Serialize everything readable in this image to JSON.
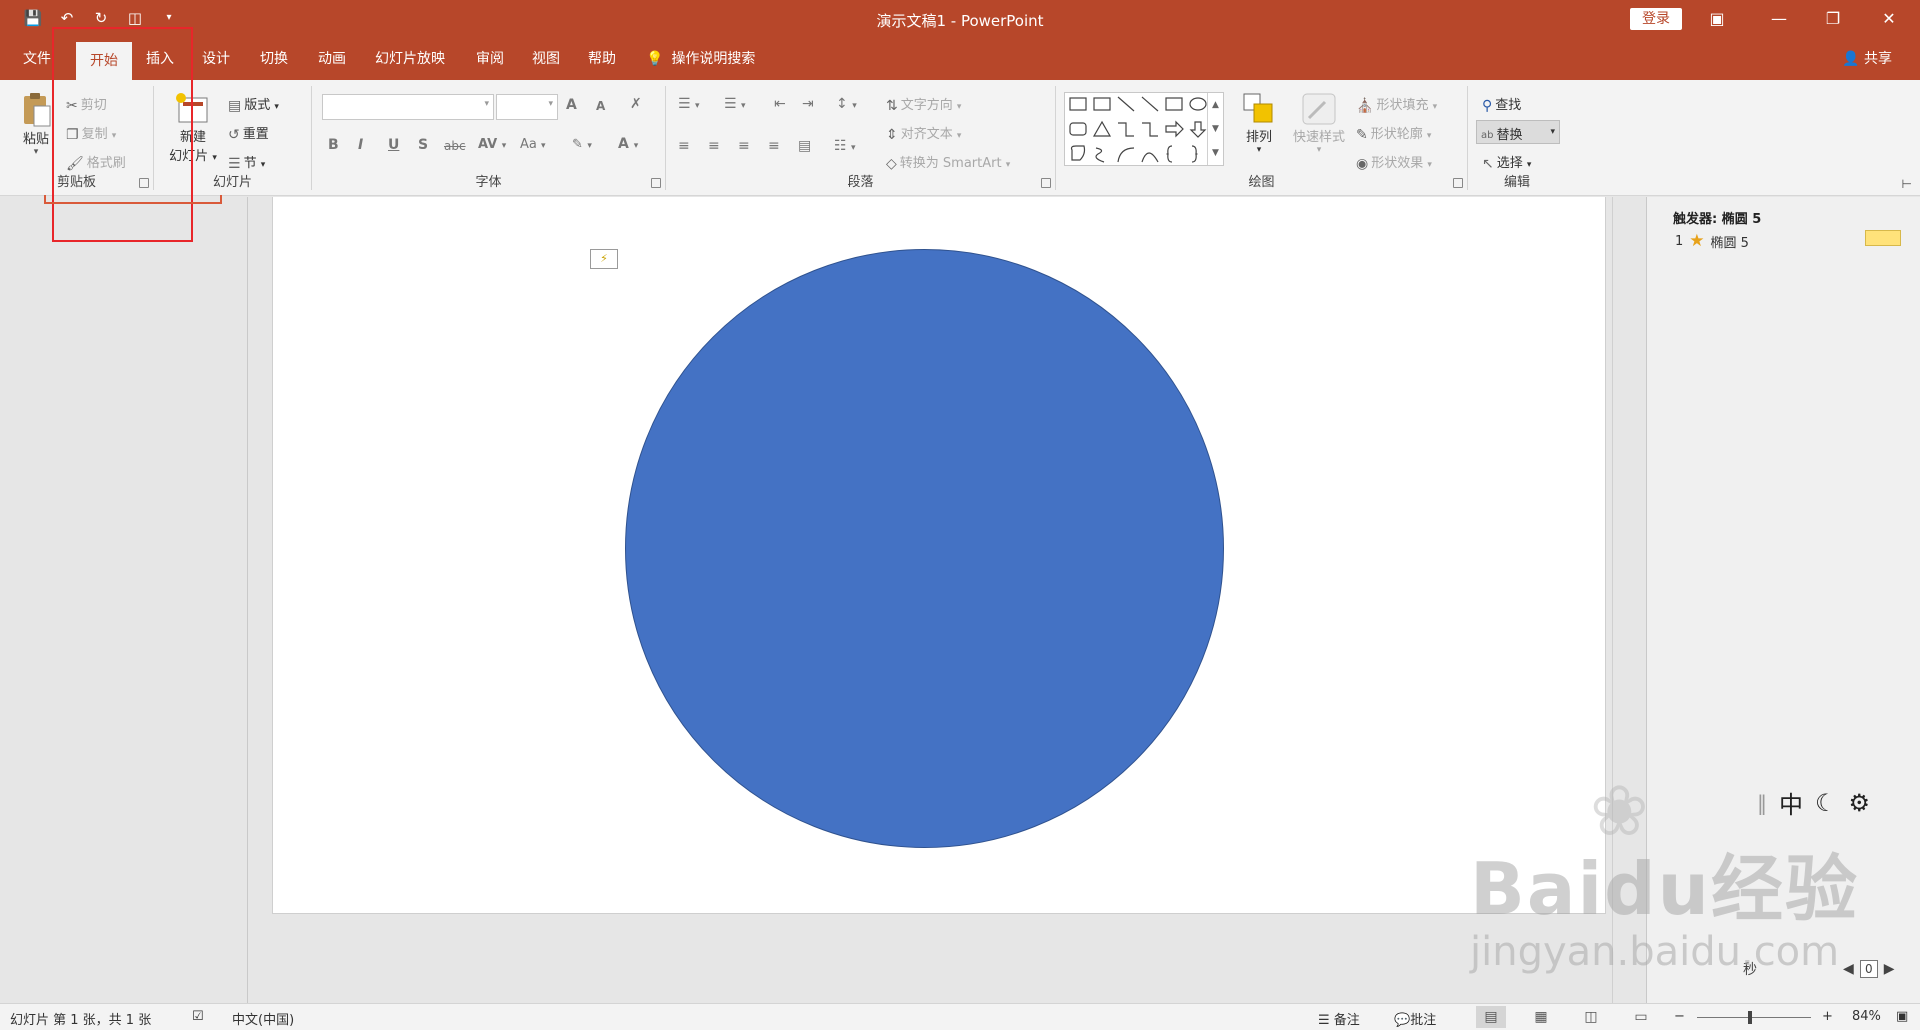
{
  "app": {
    "title": "演示文稿1  -  PowerPoint",
    "login": "登录",
    "accent": "#b7472a"
  },
  "qat": {
    "icons": [
      "save-icon",
      "undo-icon",
      "redo-icon",
      "slideshow-from-start-icon",
      "customize-qat-icon"
    ]
  },
  "tabs": [
    {
      "label": "文件",
      "active": false
    },
    {
      "label": "开始",
      "active": true
    },
    {
      "label": "插入",
      "active": false
    },
    {
      "label": "设计",
      "active": false
    },
    {
      "label": "切换",
      "active": false
    },
    {
      "label": "动画",
      "active": false
    },
    {
      "label": "幻灯片放映",
      "active": false
    },
    {
      "label": "审阅",
      "active": false
    },
    {
      "label": "视图",
      "active": false
    },
    {
      "label": "帮助",
      "active": false
    }
  ],
  "tell_me": "操作说明搜索",
  "share": "共享",
  "ribbon": {
    "clipboard": {
      "label": "剪贴板",
      "paste": "粘贴",
      "cut": "剪切",
      "copy": "复制",
      "format_painter": "格式刷"
    },
    "slides": {
      "label": "幻灯片",
      "new_slide_line1": "新建",
      "new_slide_line2": "幻灯片",
      "layout": "版式",
      "reset": "重置",
      "section": "节"
    },
    "font": {
      "label": "字体",
      "bold": "B",
      "italic": "I",
      "underline": "U",
      "shadow": "S",
      "strike": "abc",
      "spacing": "AV",
      "case": "Aa",
      "grow": "A",
      "shrink": "A"
    },
    "paragraph": {
      "label": "段落",
      "text_direction": "文字方向",
      "align_text": "对齐文本",
      "smartart": "转换为 SmartArt"
    },
    "drawing": {
      "label": "绘图",
      "arrange": "排列",
      "quick_styles": "快速样式",
      "shape_fill": "形状填充",
      "shape_outline": "形状轮廓",
      "shape_effects": "形状效果"
    },
    "editing": {
      "label": "编辑",
      "find": "查找",
      "replace": "替换",
      "select": "选择"
    }
  },
  "slide": {
    "shape_color": "#4472c4",
    "anim_tag": "⚡"
  },
  "animation_pane": {
    "trigger": "触发器: 椭圆 5",
    "item_index": "1",
    "item_name": "椭圆 5",
    "lang_cn": "中",
    "seconds_label": "秒",
    "page_box": "0"
  },
  "statusbar": {
    "slide_info": "幻灯片 第 1 张，共 1 张",
    "language": "中文(中国)",
    "notes": "备注",
    "comments": "批注",
    "zoom": "84%"
  },
  "watermark": {
    "brand": "Baidu经验",
    "url": "jingyan.baidu.com"
  }
}
